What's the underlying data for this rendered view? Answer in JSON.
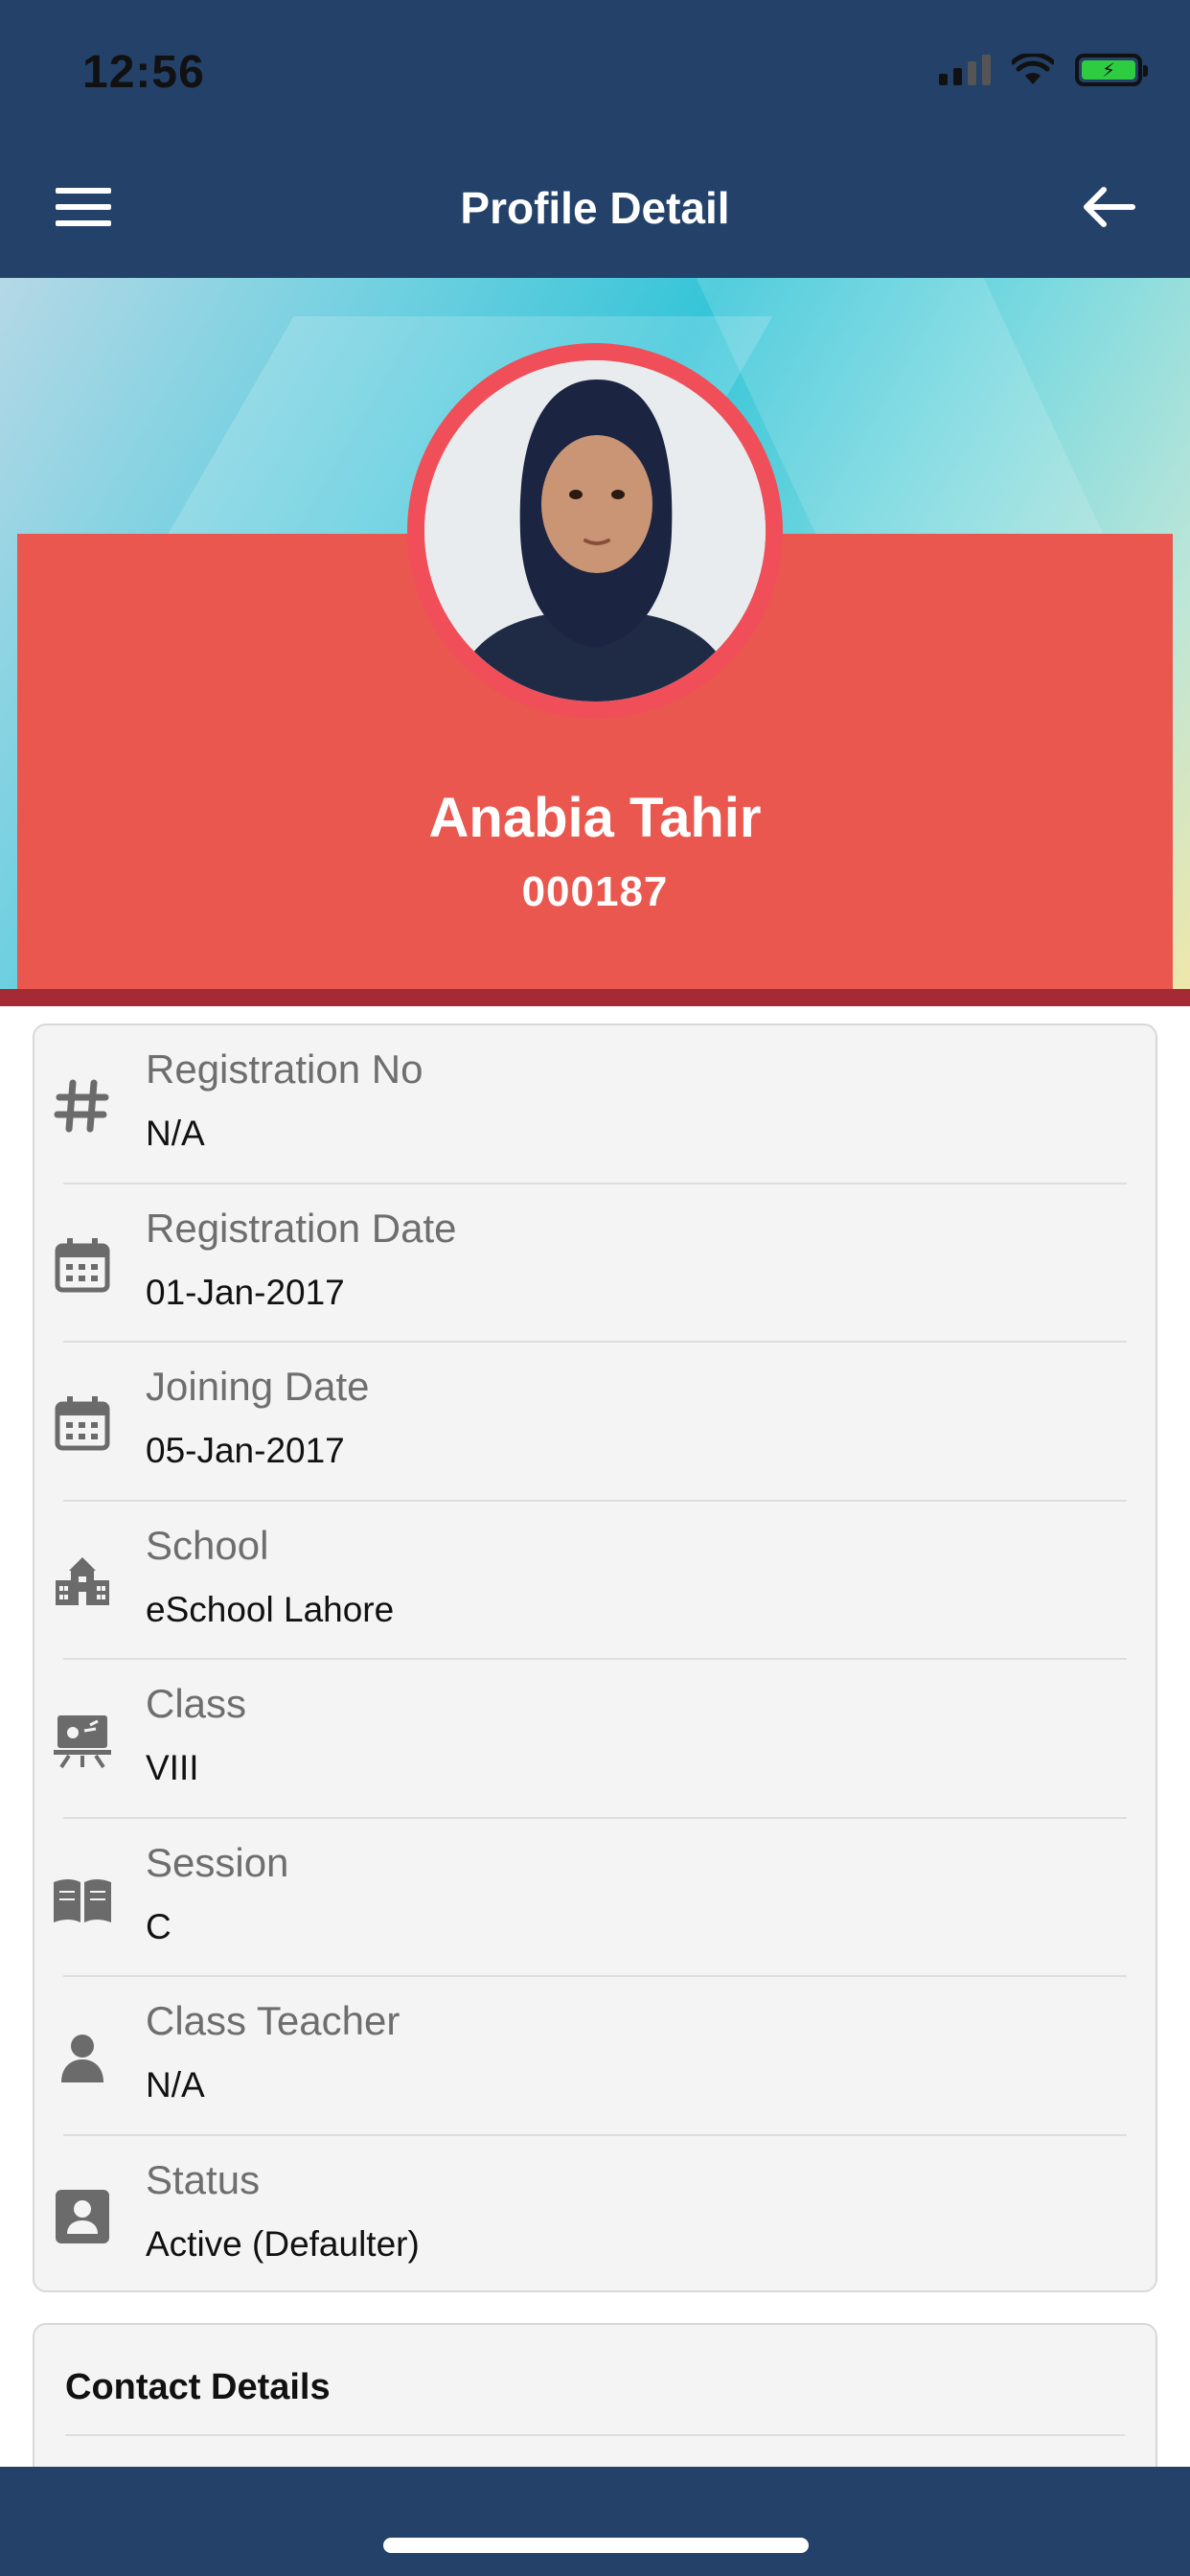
{
  "status_bar": {
    "time": "12:56"
  },
  "header": {
    "title": "Profile Detail",
    "menu_icon": "menu-icon",
    "back_icon": "arrow-left-icon"
  },
  "profile": {
    "name": "Anabia Tahir",
    "id": "000187"
  },
  "info": [
    {
      "icon": "hash-icon",
      "label": "Registration No",
      "value": "N/A"
    },
    {
      "icon": "calendar-icon",
      "label": "Registration Date",
      "value": "01-Jan-2017"
    },
    {
      "icon": "calendar-icon",
      "label": "Joining Date",
      "value": "05-Jan-2017"
    },
    {
      "icon": "school-building-icon",
      "label": "School",
      "value": "eSchool Lahore"
    },
    {
      "icon": "classroom-board-icon",
      "label": "Class",
      "value": "VIII"
    },
    {
      "icon": "open-book-icon",
      "label": "Session",
      "value": "C"
    },
    {
      "icon": "person-icon",
      "label": "Class Teacher",
      "value": "N/A"
    },
    {
      "icon": "account-box-icon",
      "label": "Status",
      "value": "Active (Defaulter)"
    }
  ],
  "contact": {
    "title": "Contact Details"
  },
  "colors": {
    "navbar": "#234169",
    "card_red": "#e9574e",
    "accent_line": "#a52a33",
    "avatar_ring": "#f04e58"
  }
}
